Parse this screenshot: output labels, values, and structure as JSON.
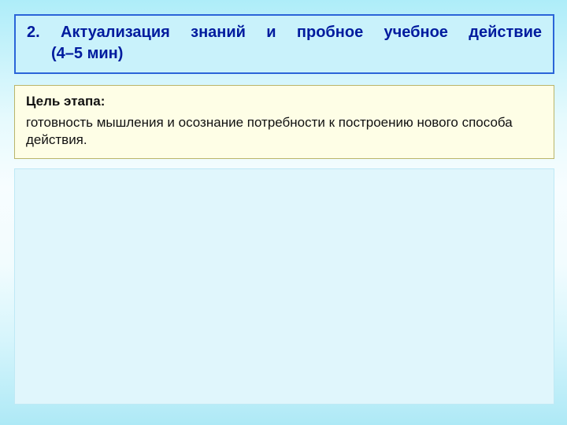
{
  "title": {
    "line1": "2. Актуализация знаний и пробное учебное действие",
    "line2": "(4–5 мин)"
  },
  "goal": {
    "label": "Цель этапа:",
    "body": "готовность мышления и осознание потребности к построению нового способа действия."
  }
}
